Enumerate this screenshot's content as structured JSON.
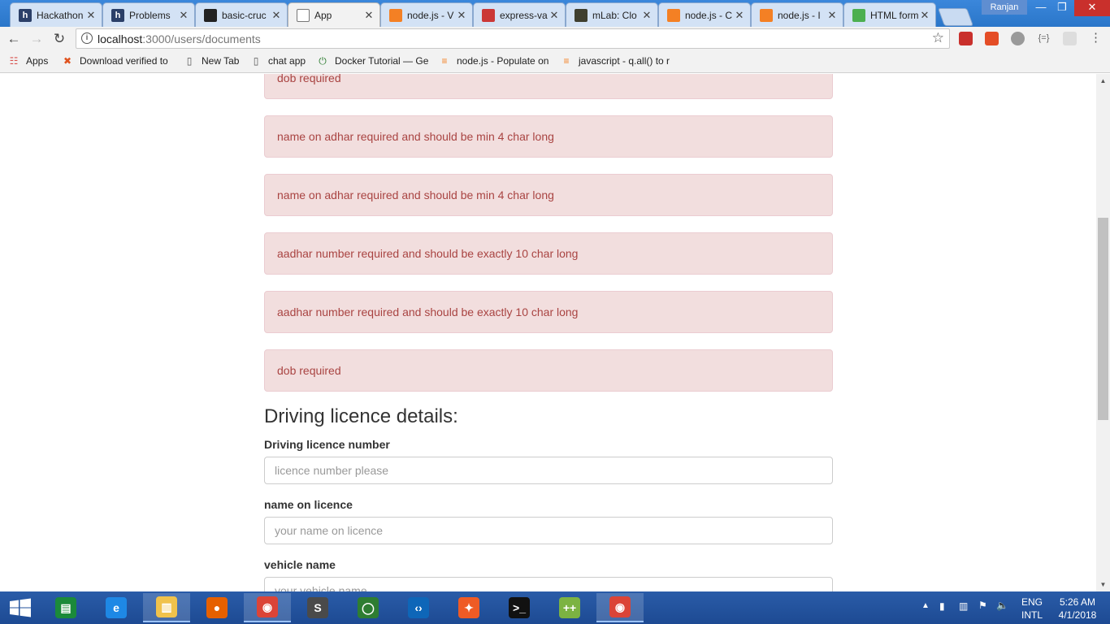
{
  "browser": {
    "tabs": [
      {
        "title": "Hackathon",
        "favicon": "h",
        "color": "#2b3f68",
        "active": false
      },
      {
        "title": "Problems",
        "favicon": "h",
        "color": "#2b3f68",
        "active": false
      },
      {
        "title": "basic-cruc",
        "favicon": "github",
        "color": "#222222",
        "active": false
      },
      {
        "title": "App",
        "favicon": "page",
        "color": "#ffffff",
        "active": true
      },
      {
        "title": "node.js - V",
        "favicon": "so",
        "color": "#f48024",
        "active": false
      },
      {
        "title": "express-va",
        "favicon": "npm",
        "color": "#cb3837",
        "active": false
      },
      {
        "title": "mLab: Clo",
        "favicon": "mlab",
        "color": "#3f3f2f",
        "active": false
      },
      {
        "title": "node.js - C",
        "favicon": "so",
        "color": "#f48024",
        "active": false
      },
      {
        "title": "node.js - I",
        "favicon": "so",
        "color": "#f48024",
        "active": false
      },
      {
        "title": "HTML form",
        "favicon": "w3",
        "color": "#4caf50",
        "active": false
      }
    ],
    "profile_name": "Ranjan",
    "url_host": "localhost",
    "url_path": ":3000/users/documents",
    "bookmarks": [
      {
        "label": "Apps",
        "icon": "apps-grid-icon"
      },
      {
        "label": "Download verified to",
        "icon": "x-icon"
      },
      {
        "label": "New Tab",
        "icon": "page-icon"
      },
      {
        "label": "chat app",
        "icon": "page-icon"
      },
      {
        "label": "Docker Tutorial — Ge",
        "icon": "power-icon"
      },
      {
        "label": "node.js - Populate on",
        "icon": "stackoverflow-icon"
      },
      {
        "label": "javascript - q.all() to r",
        "icon": "stackoverflow-icon"
      }
    ]
  },
  "page": {
    "alerts": [
      "dob required",
      "name on adhar required and should be min 4 char long",
      "name on adhar required and should be min 4 char long",
      "aadhar number required and should be exactly 10 char long",
      "aadhar number required and should be exactly 10 char long",
      "dob required"
    ],
    "section_title": "Driving licence details:",
    "fields": [
      {
        "label": "Driving licence number",
        "placeholder": "licence number please"
      },
      {
        "label": "name on licence",
        "placeholder": "your name on licence"
      },
      {
        "label": "vehicle name",
        "placeholder": "your vehicle name"
      }
    ],
    "alert_colors": {
      "background": "#f2dede",
      "border": "#ebccd1",
      "text": "#a94442"
    }
  },
  "taskbar": {
    "apps": [
      {
        "name": "store-icon",
        "active": false
      },
      {
        "name": "internet-explorer-icon",
        "active": false
      },
      {
        "name": "file-explorer-icon",
        "active": true
      },
      {
        "name": "firefox-icon",
        "active": false
      },
      {
        "name": "chrome-icon",
        "active": true
      },
      {
        "name": "sublime-text-icon",
        "active": false
      },
      {
        "name": "circle-app-icon",
        "active": false
      },
      {
        "name": "vscode-icon",
        "active": false
      },
      {
        "name": "postman-icon",
        "active": false
      },
      {
        "name": "terminal-icon",
        "active": false
      },
      {
        "name": "notepad-plus-icon",
        "active": false
      },
      {
        "name": "chrome-icon",
        "active": true
      }
    ],
    "language_line1": "ENG",
    "language_line2": "INTL",
    "time": "5:26 AM",
    "date": "4/1/2018"
  }
}
